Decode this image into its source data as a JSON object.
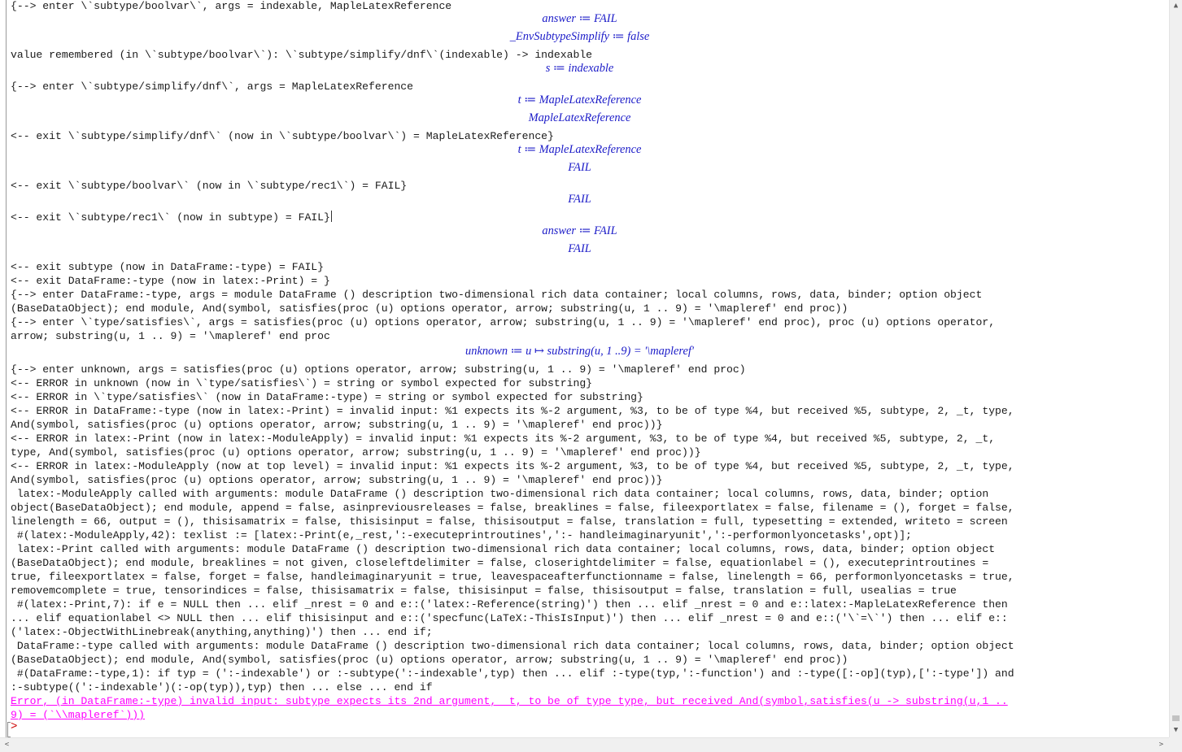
{
  "trace_lines": [
    "{--> enter \\`subtype/boolvar\\`, args = indexable, MapleLatexReference",
    "value remembered (in \\`subtype/boolvar\\`): \\`subtype/simplify/dnf\\`(indexable) -> indexable",
    "{--> enter \\`subtype/simplify/dnf\\`, args = MapleLatexReference",
    "<-- exit \\`subtype/simplify/dnf\\` (now in \\`subtype/boolvar\\`) = MapleLatexReference}",
    "<-- exit \\`subtype/boolvar\\` (now in \\`subtype/rec1\\`) = FAIL}",
    "<-- exit \\`subtype/rec1\\` (now in subtype) = FAIL}",
    "<-- exit subtype (now in DataFrame:-type) = FAIL}",
    "<-- exit DataFrame:-type (now in latex:-Print) = }",
    "{--> enter DataFrame:-type, args = module DataFrame () description two-dimensional rich data container; local columns, rows, data, binder; option object",
    "(BaseDataObject); end module, And(symbol, satisfies(proc (u) options operator, arrow; substring(u, 1 .. 9) = '\\mapleref' end proc))",
    "{--> enter \\`type/satisfies\\`, args = satisfies(proc (u) options operator, arrow; substring(u, 1 .. 9) = '\\mapleref' end proc), proc (u) options operator,",
    "arrow; substring(u, 1 .. 9) = '\\mapleref' end proc",
    "{--> enter unknown, args = satisfies(proc (u) options operator, arrow; substring(u, 1 .. 9) = '\\mapleref' end proc)",
    "<-- ERROR in unknown (now in \\`type/satisfies\\`) = string or symbol expected for substring}",
    "<-- ERROR in \\`type/satisfies\\` (now in DataFrame:-type) = string or symbol expected for substring}",
    "<-- ERROR in DataFrame:-type (now in latex:-Print) = invalid input: %1 expects its %-2 argument, %3, to be of type %4, but received %5, subtype, 2, _t, type,",
    "And(symbol, satisfies(proc (u) options operator, arrow; substring(u, 1 .. 9) = '\\mapleref' end proc))}",
    "<-- ERROR in latex:-Print (now in latex:-ModuleApply) = invalid input: %1 expects its %-2 argument, %3, to be of type %4, but received %5, subtype, 2, _t,",
    "type, And(symbol, satisfies(proc (u) options operator, arrow; substring(u, 1 .. 9) = '\\mapleref' end proc))}",
    "<-- ERROR in latex:-ModuleApply (now at top level) = invalid input: %1 expects its %-2 argument, %3, to be of type %4, but received %5, subtype, 2, _t, type,",
    "And(symbol, satisfies(proc (u) options operator, arrow; substring(u, 1 .. 9) = '\\mapleref' end proc))}",
    " latex:-ModuleApply called with arguments: module DataFrame () description two-dimensional rich data container; local columns, rows, data, binder; option",
    "object(BaseDataObject); end module, append = false, asinpreviousreleases = false, breaklines = false, fileexportlatex = false, filename = (), forget = false,",
    "linelength = 66, output = (), thisisamatrix = false, thisisinput = false, thisisoutput = false, translation = full, typesetting = extended, writeto = screen",
    " #(latex:-ModuleApply,42): texlist := [latex:-Print(e,_rest,':-executeprintroutines',':- handleimaginaryunit',':-performonlyoncetasks',opt)];",
    " latex:-Print called with arguments: module DataFrame () description two-dimensional rich data container; local columns, rows, data, binder; option object",
    "(BaseDataObject); end module, breaklines = not given, closeleftdelimiter = false, closerightdelimiter = false, equationlabel = (), executeprintroutines =",
    "true, fileexportlatex = false, forget = false, handleimaginaryunit = true, leavespaceafterfunctionname = false, linelength = 66, performonlyoncetasks = true,",
    "removemcomplete = true, tensorindices = false, thisisamatrix = false, thisisinput = false, thisisoutput = false, translation = full, usealias = true",
    " #(latex:-Print,7): if e = NULL then ... elif _nrest = 0 and e::('latex:-Reference(string)') then ... elif _nrest = 0 and e::latex:-MapleLatexReference then",
    "... elif equationlabel <> NULL then ... elif thisisinput and e::('specfunc(LaTeX:-ThisIsInput)') then ... elif _nrest = 0 and e::('\\`=\\`') then ... elif e::",
    "('latex:-ObjectWithLinebreak(anything,anything)') then ... end if;",
    " DataFrame:-type called with arguments: module DataFrame () description two-dimensional rich data container; local columns, rows, data, binder; option object",
    "(BaseDataObject); end module, And(symbol, satisfies(proc (u) options operator, arrow; substring(u, 1 .. 9) = '\\mapleref' end proc))",
    " #(DataFrame:-type,1): if typ = (':-indexable') or :-subtype(':-indexable',typ) then ... elif :-type(typ,':-function') and :-type([:-op](typ),[':-type']) and",
    ":-subtype((':-indexable')(:-op(typ)),typ) then ... else ... end if"
  ],
  "math_outputs": [
    "answer ≔ FAIL",
    "_EnvSubtypeSimplify ≔ false",
    "s ≔ indexable",
    "t ≔ MapleLatexReference",
    "MapleLatexReference",
    "t ≔ MapleLatexReference",
    "FAIL",
    "FAIL",
    "answer ≔ FAIL",
    "FAIL",
    "unknown ≔ u ↦ substring(u, 1 ..9) = '\\mapleref'"
  ],
  "error_lines": [
    "Error, (in DataFrame:-type) invalid input: subtype expects its 2nd argument, _t, to be of type type, but received And(symbol,satisfies(u -> substring(u,1 ..",
    "9) = (`\\\\mapleref`)))"
  ],
  "prompt": ">",
  "scrollbar": {
    "up": "▲",
    "down": "▼",
    "left": "<",
    "right": ">"
  }
}
